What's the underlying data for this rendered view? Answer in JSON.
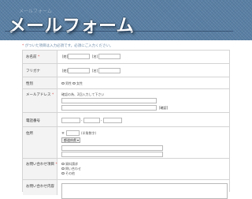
{
  "header": {
    "title": "メールフォーム",
    "ghost_text": "メールフォーム"
  },
  "notice": {
    "mark": "*",
    "text": " がついた項目は入力必須です。必須にご入力ください。"
  },
  "form": {
    "name": {
      "label": "お名前",
      "required_mark": "*",
      "sei_tag": "[姓]",
      "mei_tag": "[名]"
    },
    "furigana": {
      "label": "フリガナ",
      "sei_tag": "[姓]",
      "mei_tag": "[名]"
    },
    "gender": {
      "label": "性別",
      "options": [
        "男性",
        "女性"
      ]
    },
    "email": {
      "label": "メールアドレス",
      "required_mark": "*",
      "hint": "確認の為、2回入力して下さい",
      "confirm_tag": "[確認]"
    },
    "phone": {
      "label": "電話番号",
      "sep1": "-",
      "sep2": "-"
    },
    "address": {
      "label": "住所",
      "postal_mark": "〒",
      "postal_hint": "(半角数字)",
      "prefecture_selected": "都道府県"
    },
    "inquiry_type": {
      "label": "お問い合わせ項目",
      "required_mark": "*",
      "options": [
        "資料請求",
        "問い合わせ",
        "その他"
      ]
    },
    "inquiry_body": {
      "label": "お問い合わせ内容"
    }
  },
  "colors": {
    "banner": "#587ea3",
    "required": "#d9534f",
    "label_bg": "#f3f3f3"
  }
}
